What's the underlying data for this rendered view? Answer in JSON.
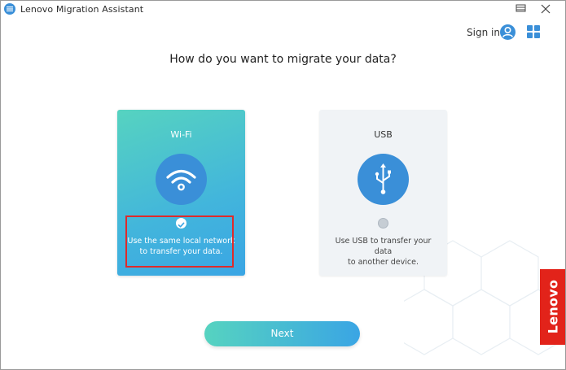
{
  "window": {
    "title": "Lenovo Migration Assistant",
    "controls": [
      {
        "name": "restore",
        "icon": "restore-icon"
      },
      {
        "name": "close",
        "icon": "close-icon",
        "glyph": "✕"
      }
    ]
  },
  "header": {
    "signin_label": "Sign in",
    "user_icon": "user-icon",
    "menu_icon": "grid-icon"
  },
  "main": {
    "question": "How do you want to migrate your data?",
    "options": [
      {
        "title": "Wi-Fi",
        "icon": "wifi-icon",
        "selected": true,
        "description_line1": "Use the same local network",
        "description_line2": "to transfer your data."
      },
      {
        "title": "USB",
        "icon": "usb-icon",
        "selected": false,
        "description_line1": "Use USB to transfer your data",
        "description_line2": "to another device."
      }
    ],
    "next_label": "Next"
  },
  "brand": {
    "logo_text": "Lenovo",
    "color": "#e2231a"
  },
  "colors": {
    "accent": "#3a8fd8",
    "gradient_start": "#56d3c0",
    "gradient_end": "#3aa5e4",
    "highlight": "#e02a2a"
  }
}
